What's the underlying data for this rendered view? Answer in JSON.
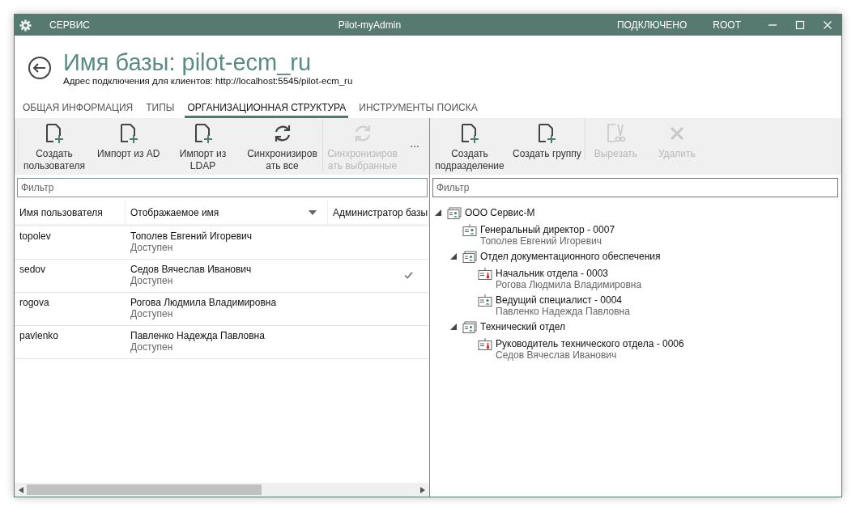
{
  "window": {
    "menu": "СЕРВИС",
    "title": "Pilot-myAdmin",
    "status": "ПОДКЛЮЧЕНО",
    "user": "ROOT"
  },
  "header": {
    "title": "Имя базы: pilot-ecm_ru",
    "address": "Адрес подключения для клиентов: http://localhost:5545/pilot-ecm_ru"
  },
  "tabs": [
    {
      "label": "ОБЩАЯ ИНФОРМАЦИЯ",
      "selected": false
    },
    {
      "label": "ТИПЫ",
      "selected": false
    },
    {
      "label": "ОРГАНИЗАЦИОННАЯ СТРУКТУРА",
      "selected": true
    },
    {
      "label": "ИНСТРУМЕНТЫ ПОИСКА",
      "selected": false
    }
  ],
  "users_pane": {
    "toolbar": [
      {
        "label": "Создать пользователя",
        "kind": "add",
        "disabled": false
      },
      {
        "label": "Импорт из AD",
        "kind": "add",
        "disabled": false
      },
      {
        "label": "Импорт из LDAP",
        "kind": "add",
        "disabled": false
      },
      {
        "label": "Синхронизировать все",
        "kind": "sync",
        "disabled": false
      },
      {
        "label": "Синхронизировать выбранные",
        "kind": "sync",
        "disabled": true
      }
    ],
    "more": "...",
    "filter": {
      "placeholder": "Фильтр"
    },
    "columns": [
      "Имя пользователя",
      "Отображаемое имя",
      "Администратор базы"
    ],
    "rows": [
      {
        "username": "topolev",
        "display_name": "Тополев Евгений Игоревич",
        "status": "Доступен",
        "admin": false
      },
      {
        "username": "sedov",
        "display_name": "Седов Вячеслав Иванович",
        "status": "Доступен",
        "admin": true
      },
      {
        "username": "rogova",
        "display_name": "Рогова Людмила Владимировна",
        "status": "Доступен",
        "admin": false
      },
      {
        "username": "pavlenko",
        "display_name": "Павленко Надежда Павловна",
        "status": "Доступен",
        "admin": false
      }
    ]
  },
  "structure_pane": {
    "toolbar": [
      {
        "label": "Создать подразделение",
        "kind": "add",
        "disabled": false
      },
      {
        "label": "Создать группу",
        "kind": "add",
        "disabled": false
      },
      {
        "label": "Вырезать",
        "kind": "cut",
        "disabled": true
      },
      {
        "label": "Удалить",
        "kind": "delete",
        "disabled": true
      }
    ],
    "filter": {
      "placeholder": "Фильтр"
    },
    "tree": [
      {
        "kind": "unit",
        "label": "ООО Сервис-М",
        "expanded": true,
        "children": [
          {
            "kind": "position",
            "label": "Генеральный директор - 0007",
            "person": "Тополев Евгений Игоревич"
          },
          {
            "kind": "unit",
            "label": "Отдел документационного обеспечения",
            "expanded": true,
            "children": [
              {
                "kind": "head",
                "label": "Начальник отдела - 0003",
                "person": "Рогова Людмила Владимировна"
              },
              {
                "kind": "position",
                "label": "Ведущий специалист - 0004",
                "person": "Павленко Надежда Павловна"
              }
            ]
          },
          {
            "kind": "unit",
            "label": "Технический отдел",
            "expanded": true,
            "children": [
              {
                "kind": "head",
                "label": "Руководитель технического отдела - 0006",
                "person": "Седов Вячеслав Иванович"
              }
            ]
          }
        ]
      }
    ]
  }
}
